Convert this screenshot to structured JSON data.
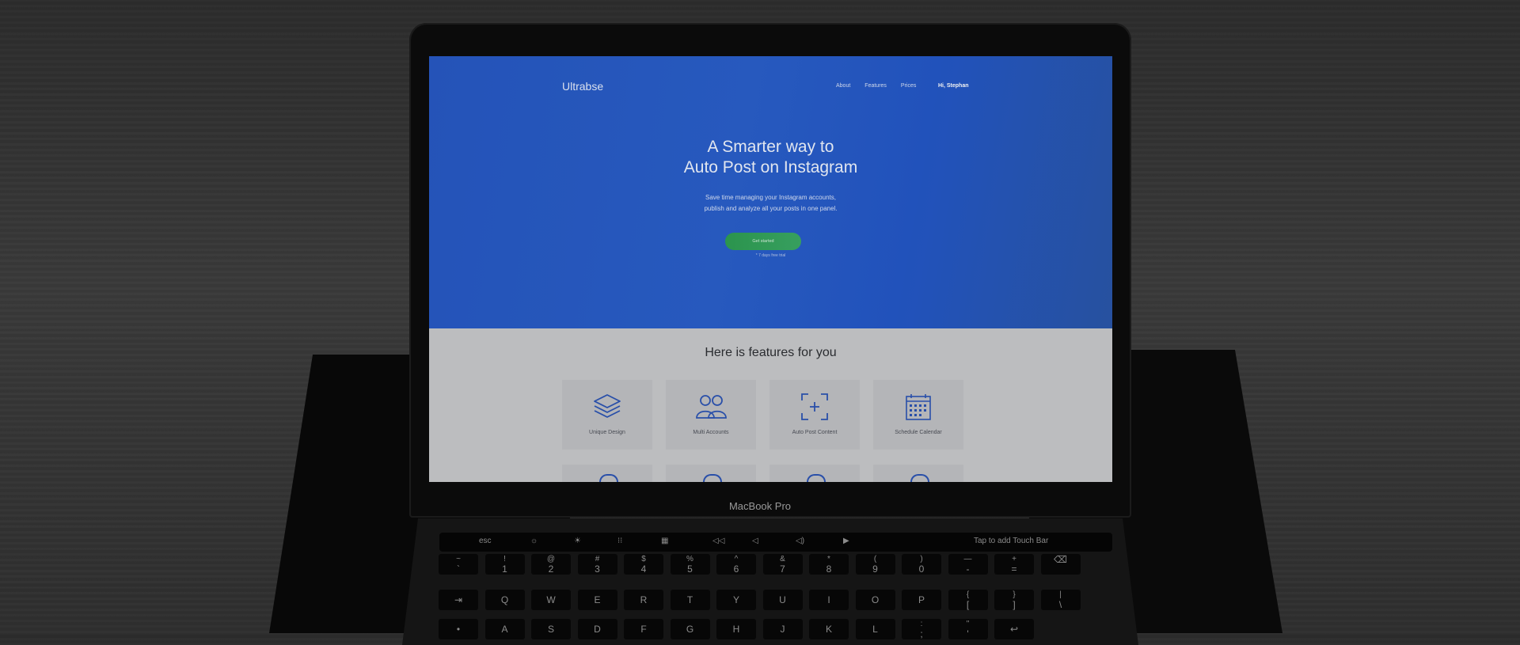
{
  "device": {
    "model_label": "MacBook Pro",
    "touchbar": [
      "esc",
      "☼",
      "☀",
      "⁝⁝",
      "▦",
      "◁◁",
      "◁",
      "◁)",
      "▶",
      "Tap to add Touch Bar"
    ],
    "keys_row1": [
      [
        "~",
        "`"
      ],
      [
        "!",
        "1"
      ],
      [
        "@",
        "2"
      ],
      [
        "#",
        "3"
      ],
      [
        "$",
        "4"
      ],
      [
        "%",
        "5"
      ],
      [
        "^",
        "6"
      ],
      [
        "&",
        "7"
      ],
      [
        "*",
        "8"
      ],
      [
        "(",
        "9"
      ],
      [
        ")",
        "0"
      ],
      [
        "—",
        "-"
      ],
      [
        "+",
        "="
      ],
      [
        "",
        "⌫"
      ]
    ],
    "keys_row2": [
      "⇥",
      "Q",
      "W",
      "E",
      "R",
      "T",
      "Y",
      "U",
      "I",
      "O",
      "P",
      [
        "{",
        "["
      ],
      [
        "}",
        "]"
      ],
      [
        "|",
        "\\"
      ]
    ],
    "keys_row3": [
      "•",
      "A",
      "S",
      "D",
      "F",
      "G",
      "H",
      "J",
      "K",
      "L",
      [
        ":",
        ";"
      ],
      [
        "\"",
        "'"
      ],
      "↩"
    ]
  },
  "site": {
    "logo": "Ultrabse",
    "nav": [
      "About",
      "Features",
      "Prices"
    ],
    "user_greeting": "Hi, Stephan",
    "hero": {
      "title_line1": "A Smarter way to",
      "title_line2": "Auto Post on Instagram",
      "subtitle_line1": "Save time managing your Instagram accounts,",
      "subtitle_line2": "publish and analyze all your posts in one panel.",
      "cta_label": "Get started",
      "trial_note": "* 7 days free trial"
    },
    "features": {
      "title": "Here is features for you",
      "cards": [
        {
          "label": "Unique Design",
          "icon": "layers-icon"
        },
        {
          "label": "Multi Accounts",
          "icon": "users-icon"
        },
        {
          "label": "Auto Post Content",
          "icon": "focus-plus-icon"
        },
        {
          "label": "Schedule Calendar",
          "icon": "calendar-icon"
        }
      ]
    }
  },
  "colors": {
    "hero_blue": "#2758c2",
    "accent_icon": "#2c54b3",
    "cta_green": "#2e9d52"
  }
}
